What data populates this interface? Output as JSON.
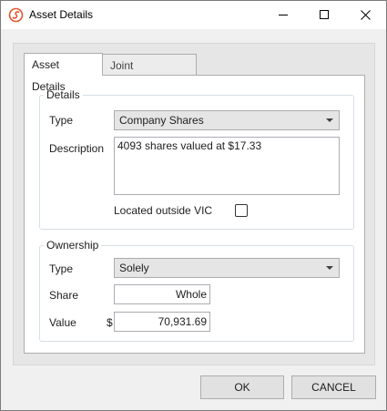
{
  "window": {
    "title": "Asset Details",
    "icon": "app-logo-icon",
    "controls": {
      "minimize": "minimize-icon",
      "maximize": "maximize-icon",
      "close": "close-icon"
    }
  },
  "tabs": [
    {
      "label": "Asset Details",
      "active": true
    },
    {
      "label": "Joint Ownership",
      "active": false
    }
  ],
  "details": {
    "group_title": "Details",
    "type_label": "Type",
    "type_value": "Company Shares",
    "description_label": "Description",
    "description_value": "4093 shares valued at $17.33",
    "outside_label": "Located outside VIC",
    "outside_checked": false
  },
  "ownership": {
    "group_title": "Ownership",
    "type_label": "Type",
    "type_value": "Solely",
    "share_label": "Share",
    "share_value": "Whole",
    "value_label": "Value",
    "currency_symbol": "$",
    "value_value": "70,931.69"
  },
  "buttons": {
    "ok": "OK",
    "cancel": "CANCEL"
  },
  "colors": {
    "accent_icon": "#e8542f"
  }
}
